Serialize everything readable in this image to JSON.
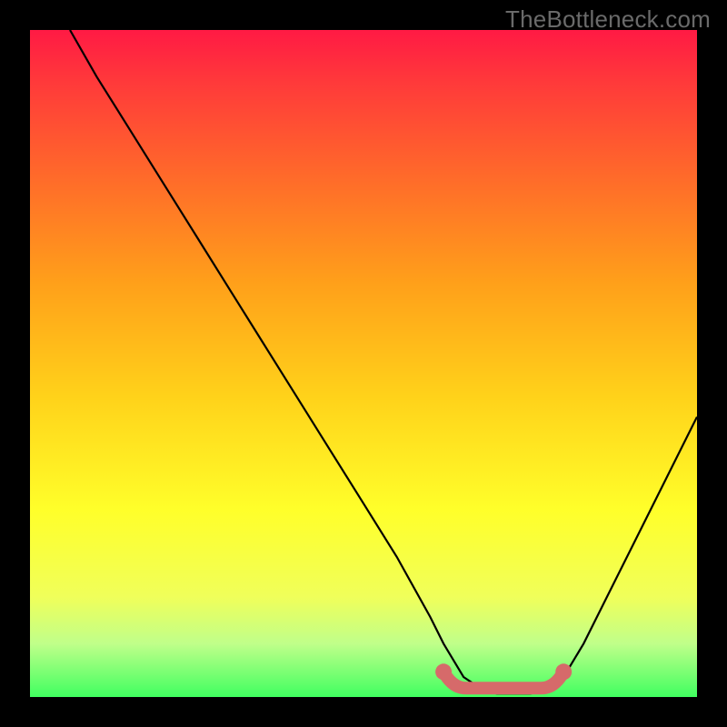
{
  "watermark": "TheBottleneck.com",
  "chart_data": {
    "type": "line",
    "title": "",
    "xlabel": "",
    "ylabel": "",
    "xlim": [
      0,
      100
    ],
    "ylim": [
      0,
      100
    ],
    "grid": false,
    "series": [
      {
        "name": "curve",
        "x": [
          6,
          10,
          15,
          20,
          25,
          30,
          35,
          40,
          45,
          50,
          55,
          60,
          62,
          65,
          68,
          70,
          72,
          75,
          78,
          80,
          83,
          86,
          90,
          95,
          100
        ],
        "values": [
          100,
          93,
          85,
          77,
          69,
          61,
          53,
          45,
          37,
          29,
          21,
          12,
          8,
          3,
          1,
          0.5,
          0.5,
          0.5,
          1,
          3,
          8,
          14,
          22,
          32,
          42
        ]
      }
    ],
    "accent_segment": {
      "x_start": 62,
      "x_end": 80,
      "y": 0.5
    }
  }
}
